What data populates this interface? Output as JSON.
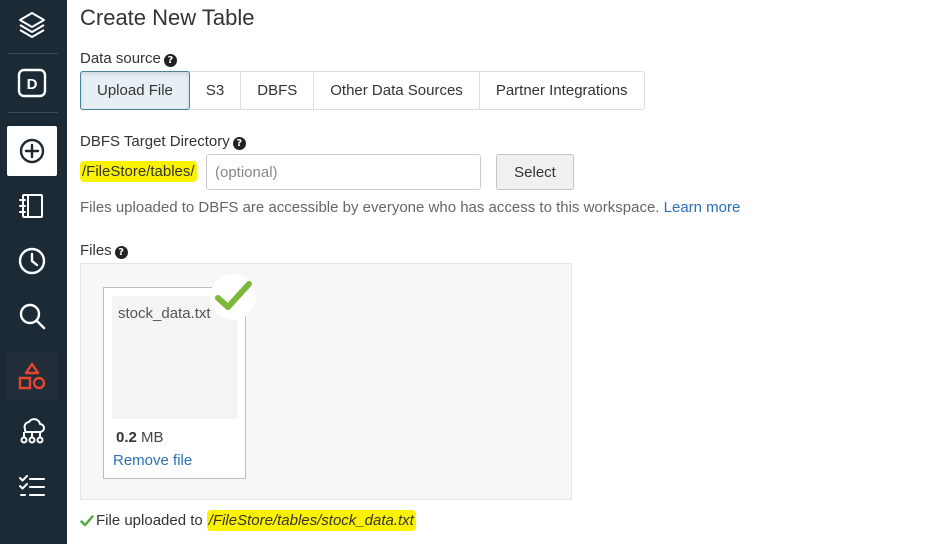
{
  "page_title": "Create New Table",
  "data_source": {
    "label": "Data source",
    "tabs": [
      "Upload File",
      "S3",
      "DBFS",
      "Other Data Sources",
      "Partner Integrations"
    ],
    "selected": "Upload File"
  },
  "dbfs_target": {
    "label": "DBFS Target Directory",
    "prefix": "/FileStore/tables/",
    "placeholder": "(optional)",
    "select_label": "Select",
    "note": "Files uploaded to DBFS are accessible by everyone who has access to this workspace.",
    "learn_more": "Learn more"
  },
  "files": {
    "label": "Files",
    "items": [
      {
        "name": "stock_data.txt",
        "size_value": "0.2",
        "size_unit": "MB",
        "remove_label": "Remove file"
      }
    ]
  },
  "status": {
    "text": "File uploaded to",
    "path": "/FileStore/tables/stock_data.txt"
  },
  "colors": {
    "sidebar_bg": "#1b2a35",
    "accent_red": "#e8452c",
    "link_blue": "#2a70b8",
    "success_green": "#7cb83a",
    "highlight_yellow": "#fbf200"
  },
  "sidebar_icons": [
    "layers-icon",
    "workspace-d-icon",
    "create-plus-icon",
    "notebook-icon",
    "recent-clock-icon",
    "search-icon",
    "shapes-icon",
    "cluster-icon",
    "jobs-checklist-icon"
  ]
}
